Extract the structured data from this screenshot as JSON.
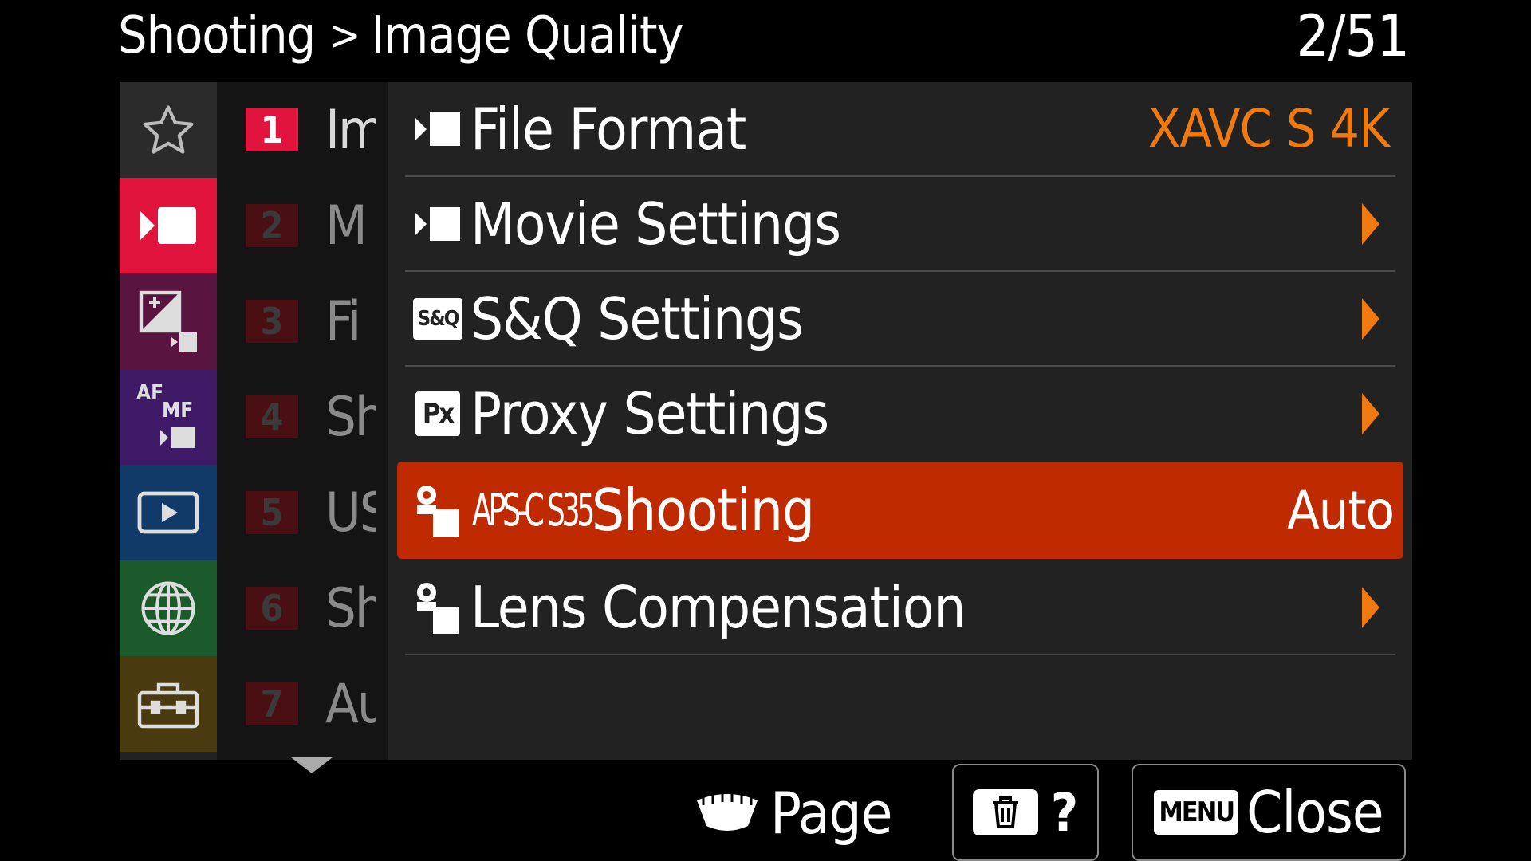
{
  "header": {
    "section": "Shooting",
    "separator": ">",
    "page_title": "Image Quality",
    "page_counter": "2/51"
  },
  "tabs": [
    {
      "id": "my-menu",
      "icon": "star-icon",
      "color": "#2b2b2b"
    },
    {
      "id": "shooting",
      "icon": "movie-icon",
      "color": "#e0143c",
      "selected": true
    },
    {
      "id": "exposure-color",
      "icon": "exposure-icon",
      "color": "#5a1440"
    },
    {
      "id": "focus",
      "icon": "af-mf-icon",
      "color": "#3f1a66",
      "text_top": "AF",
      "text_mid": "MF"
    },
    {
      "id": "playback",
      "icon": "playback-icon",
      "color": "#123a68"
    },
    {
      "id": "network",
      "icon": "globe-icon",
      "color": "#1b5a2a"
    },
    {
      "id": "setup",
      "icon": "toolbox-icon",
      "color": "#4a3a10"
    }
  ],
  "pages": [
    {
      "num": "1",
      "name": "Im",
      "active": true
    },
    {
      "num": "2",
      "name": "M"
    },
    {
      "num": "3",
      "name": "Fi"
    },
    {
      "num": "4",
      "name": "Sh"
    },
    {
      "num": "5",
      "name": "US"
    },
    {
      "num": "6",
      "name": "Sh"
    },
    {
      "num": "7",
      "name": "Au"
    }
  ],
  "menu": {
    "file_format": {
      "label": "File Format",
      "value": "XAVC S 4K"
    },
    "movie_settings": {
      "label": "Movie Settings"
    },
    "sq_settings": {
      "label": "S&Q Settings",
      "icon_text": "S&Q"
    },
    "proxy_settings": {
      "label": "Proxy Settings",
      "icon_text": "Px"
    },
    "apsc_shooting": {
      "badge": "APS-C S35",
      "label": "Shooting",
      "value": "Auto"
    },
    "lens_compensation": {
      "label": "Lens Compensation"
    }
  },
  "footer": {
    "page_label": "Page",
    "help_label": "?",
    "menu_key": "MENU",
    "close_label": "Close"
  },
  "colors": {
    "accent_orange": "#f07a10",
    "selected_row": "#c02a00",
    "shooting_tab": "#e0143c"
  }
}
